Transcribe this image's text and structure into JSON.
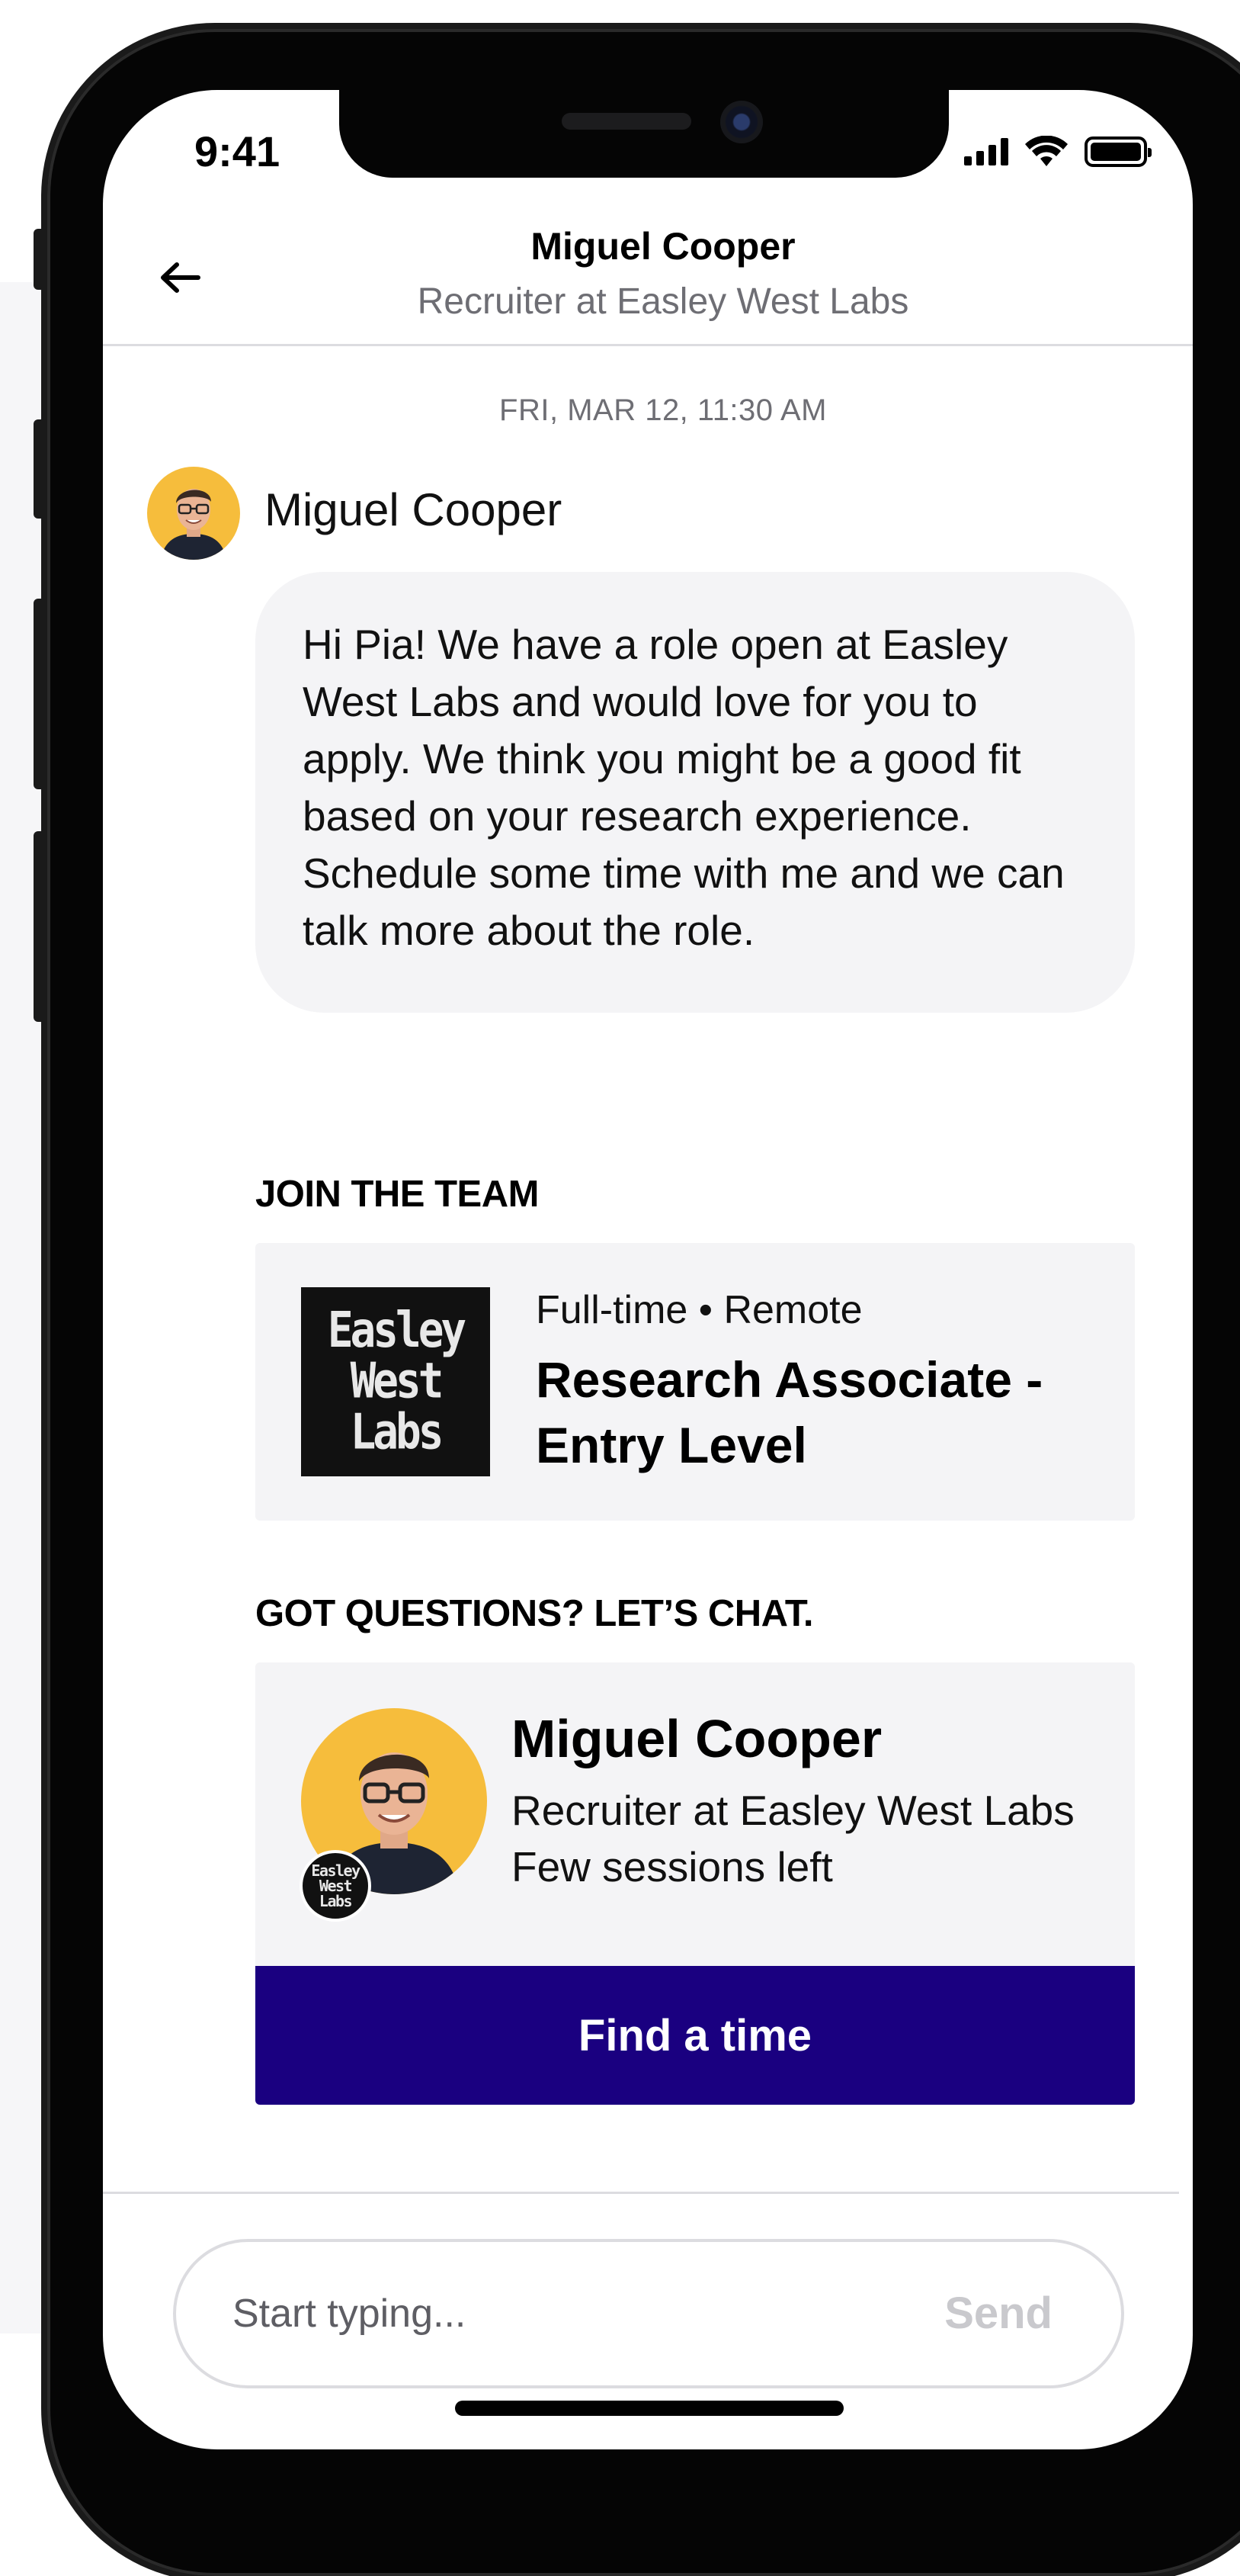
{
  "status_bar": {
    "time": "9:41"
  },
  "header": {
    "name": "Miguel Cooper",
    "subtitle": "Recruiter at Easley West Labs",
    "back_icon": "arrow-left-icon"
  },
  "conversation": {
    "timestamp": "FRI, MAR 12, 11:30 AM",
    "sender": "Miguel Cooper",
    "message": "Hi Pia! We have a role open at Easley West Labs and would love for you to apply. We think you might be a good fit based on your research experience. Schedule some time with me and we can talk more about the role."
  },
  "job_section": {
    "title": "JOIN THE TEAM",
    "logo_text": "Easley West Labs",
    "meta": "Full-time • Remote",
    "job_title": "Research Associate - Entry Level"
  },
  "chat_section": {
    "title": "GOT QUESTIONS? LET’S CHAT.",
    "recruiter_name": "Miguel Cooper",
    "recruiter_role": "Recruiter at Easley West Labs",
    "availability": "Few sessions left",
    "cta_label": "Find a time"
  },
  "composer": {
    "placeholder": "Start typing...",
    "send_label": "Send"
  },
  "colors": {
    "accent": "#1a0080",
    "avatar_bg": "#f6bd3c",
    "bubble_bg": "#f4f4f6",
    "muted_text": "#6e6e74"
  }
}
